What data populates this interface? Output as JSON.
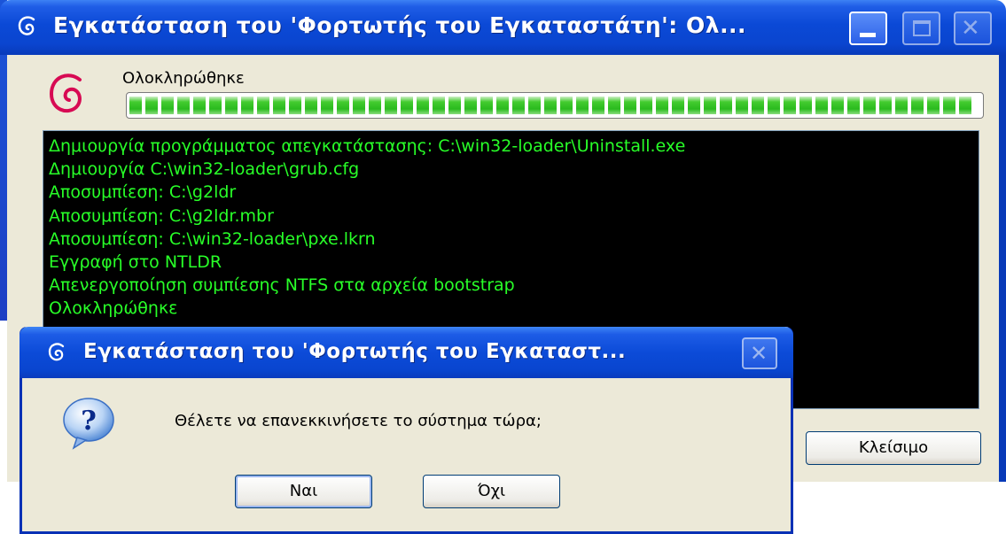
{
  "main_window": {
    "title": "Εγκατάσταση του 'Φορτωτής του Εγκαταστάτη': Ολ...",
    "status_label": "Ολοκληρώθηκε",
    "progress_fraction": 1.0,
    "log_lines": [
      "Δημιουργία προγράμματος απεγκατάστασης: C:\\win32-loader\\Uninstall.exe",
      "Δημιουργία C:\\win32-loader\\grub.cfg",
      "Αποσυμπίεση: C:\\g2ldr",
      "Αποσυμπίεση: C:\\g2ldr.mbr",
      "Αποσυμπίεση: C:\\win32-loader\\pxe.lkrn",
      "Εγγραφή στο NTLDR",
      "Απενεργοποίηση συμπίεσης NTFS στα αρχεία bootstrap",
      "Ολοκληρώθηκε"
    ],
    "close_button": "Κλείσιμο"
  },
  "dialog": {
    "title": "Εγκατάσταση του 'Φορτωτής του Εγκαταστ...",
    "message": "Θέλετε να επανεκκινήσετε το σύστημα τώρα;",
    "yes_button": "Ναι",
    "no_button": "Όχι"
  },
  "colors": {
    "titlebar": "#0a45cf",
    "log_text": "#28ff28",
    "progress": "#2aba1e",
    "debian_red": "#d70a53"
  },
  "icons": {
    "app": "debian-swirl-icon",
    "dialog": "question-icon"
  }
}
